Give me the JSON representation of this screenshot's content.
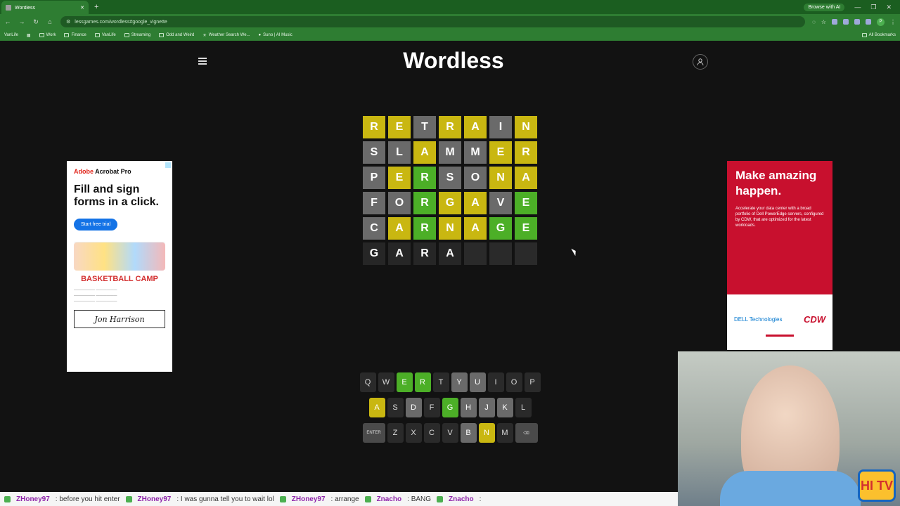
{
  "browser": {
    "tab_title": "Wordless",
    "new_tab": "+",
    "browse_ai": "Browse with AI",
    "url": "lessgames.com/wordless#google_vignette",
    "bookmarks": [
      "VanLife",
      "Work",
      "Finance",
      "VanLife",
      "Streaming",
      "Odd and Weird",
      "Weather Search We...",
      "Suno | AI Music"
    ],
    "all_bookmarks": "All Bookmarks",
    "profile_initial": "P"
  },
  "app": {
    "title": "Wordless"
  },
  "board": {
    "rows": [
      [
        {
          "l": "R",
          "s": "yellow"
        },
        {
          "l": "E",
          "s": "yellow"
        },
        {
          "l": "T",
          "s": "gray"
        },
        {
          "l": "R",
          "s": "yellow"
        },
        {
          "l": "A",
          "s": "yellow"
        },
        {
          "l": "I",
          "s": "gray"
        },
        {
          "l": "N",
          "s": "yellow"
        }
      ],
      [
        {
          "l": "S",
          "s": "gray"
        },
        {
          "l": "L",
          "s": "gray"
        },
        {
          "l": "A",
          "s": "yellow"
        },
        {
          "l": "M",
          "s": "gray"
        },
        {
          "l": "M",
          "s": "gray"
        },
        {
          "l": "E",
          "s": "yellow"
        },
        {
          "l": "R",
          "s": "yellow"
        }
      ],
      [
        {
          "l": "P",
          "s": "gray"
        },
        {
          "l": "E",
          "s": "yellow"
        },
        {
          "l": "R",
          "s": "green"
        },
        {
          "l": "S",
          "s": "gray"
        },
        {
          "l": "O",
          "s": "gray"
        },
        {
          "l": "N",
          "s": "yellow"
        },
        {
          "l": "A",
          "s": "yellow"
        }
      ],
      [
        {
          "l": "F",
          "s": "gray"
        },
        {
          "l": "O",
          "s": "gray"
        },
        {
          "l": "R",
          "s": "green"
        },
        {
          "l": "G",
          "s": "yellow"
        },
        {
          "l": "A",
          "s": "yellow"
        },
        {
          "l": "V",
          "s": "gray"
        },
        {
          "l": "E",
          "s": "green"
        }
      ],
      [
        {
          "l": "C",
          "s": "gray"
        },
        {
          "l": "A",
          "s": "yellow"
        },
        {
          "l": "R",
          "s": "green"
        },
        {
          "l": "N",
          "s": "yellow"
        },
        {
          "l": "A",
          "s": "yellow"
        },
        {
          "l": "G",
          "s": "green"
        },
        {
          "l": "E",
          "s": "green"
        }
      ],
      [
        {
          "l": "G",
          "s": "typed"
        },
        {
          "l": "A",
          "s": "typed"
        },
        {
          "l": "R",
          "s": "typed"
        },
        {
          "l": "A",
          "s": "typed"
        },
        {
          "l": "",
          "s": "empty"
        },
        {
          "l": "",
          "s": "empty"
        },
        {
          "l": "",
          "s": "empty"
        }
      ]
    ]
  },
  "keyboard": {
    "rows": [
      [
        {
          "k": "Q",
          "s": ""
        },
        {
          "k": "W",
          "s": ""
        },
        {
          "k": "E",
          "s": "green"
        },
        {
          "k": "R",
          "s": "green"
        },
        {
          "k": "T",
          "s": ""
        },
        {
          "k": "Y",
          "s": "gray"
        },
        {
          "k": "U",
          "s": "gray"
        },
        {
          "k": "I",
          "s": ""
        },
        {
          "k": "O",
          "s": ""
        },
        {
          "k": "P",
          "s": ""
        }
      ],
      [
        {
          "k": "A",
          "s": "yellow"
        },
        {
          "k": "S",
          "s": ""
        },
        {
          "k": "D",
          "s": "gray"
        },
        {
          "k": "F",
          "s": ""
        },
        {
          "k": "G",
          "s": "green"
        },
        {
          "k": "H",
          "s": "gray"
        },
        {
          "k": "J",
          "s": "gray"
        },
        {
          "k": "K",
          "s": "gray"
        },
        {
          "k": "L",
          "s": ""
        }
      ],
      [
        {
          "k": "ENTER",
          "s": "wide"
        },
        {
          "k": "Z",
          "s": ""
        },
        {
          "k": "X",
          "s": ""
        },
        {
          "k": "C",
          "s": ""
        },
        {
          "k": "V",
          "s": ""
        },
        {
          "k": "B",
          "s": "gray"
        },
        {
          "k": "N",
          "s": "yellow"
        },
        {
          "k": "M",
          "s": ""
        },
        {
          "k": "⌫",
          "s": "wide"
        }
      ]
    ]
  },
  "ads": {
    "left": {
      "brand_prefix": "Adobe",
      "brand": "Acrobat Pro",
      "headline": "Fill and sign forms in a click.",
      "cta": "Start free trial",
      "art_title": "BASKETBALL CAMP",
      "signature": "Jon Harrison"
    },
    "right": {
      "headline": "Make amazing happen.",
      "body": "Accelerate your data center with a broad portfolio of Dell PowerEdge servers, configured by CDW, that are optimized for the latest workloads.",
      "logo_left": "DELL Technologies",
      "logo_right": "CDW"
    }
  },
  "stream": {
    "logo": "HI TV",
    "ticker": [
      {
        "user": "ZHoney97",
        "msg": ": before you hit enter"
      },
      {
        "user": "ZHoney97",
        "msg": ": I was gunna tell you to wait lol"
      },
      {
        "user": "ZHoney97",
        "msg": ": arrange"
      },
      {
        "user": "Znacho",
        "msg": ": BANG"
      },
      {
        "user": "Znacho",
        "msg": ":"
      }
    ]
  }
}
